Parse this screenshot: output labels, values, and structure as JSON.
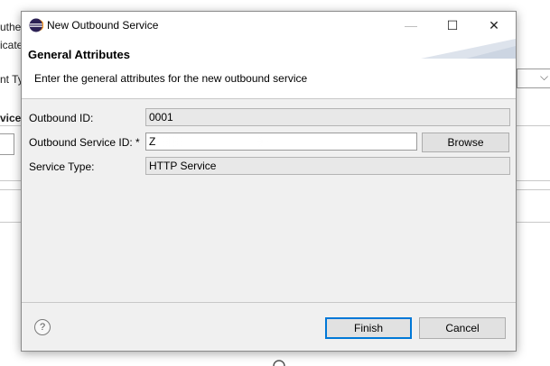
{
  "background": {
    "fragments": [
      "uther",
      "icate",
      "nt Typ",
      "vice"
    ]
  },
  "dialog": {
    "title": "New Outbound Service",
    "controls": {
      "minimize": "—",
      "maximize": "☐",
      "close": "✕"
    },
    "header": {
      "title": "General Attributes",
      "description": "Enter the general attributes for the new outbound service"
    },
    "form": {
      "outbound_id": {
        "label": "Outbound ID:",
        "value": "0001"
      },
      "outbound_service_id": {
        "label": "Outbound Service ID: *",
        "value": "Z"
      },
      "service_type": {
        "label": "Service Type:",
        "value": "HTTP Service"
      }
    },
    "buttons": {
      "browse": "Browse",
      "finish": "Finish",
      "cancel": "Cancel",
      "help": "?"
    }
  }
}
